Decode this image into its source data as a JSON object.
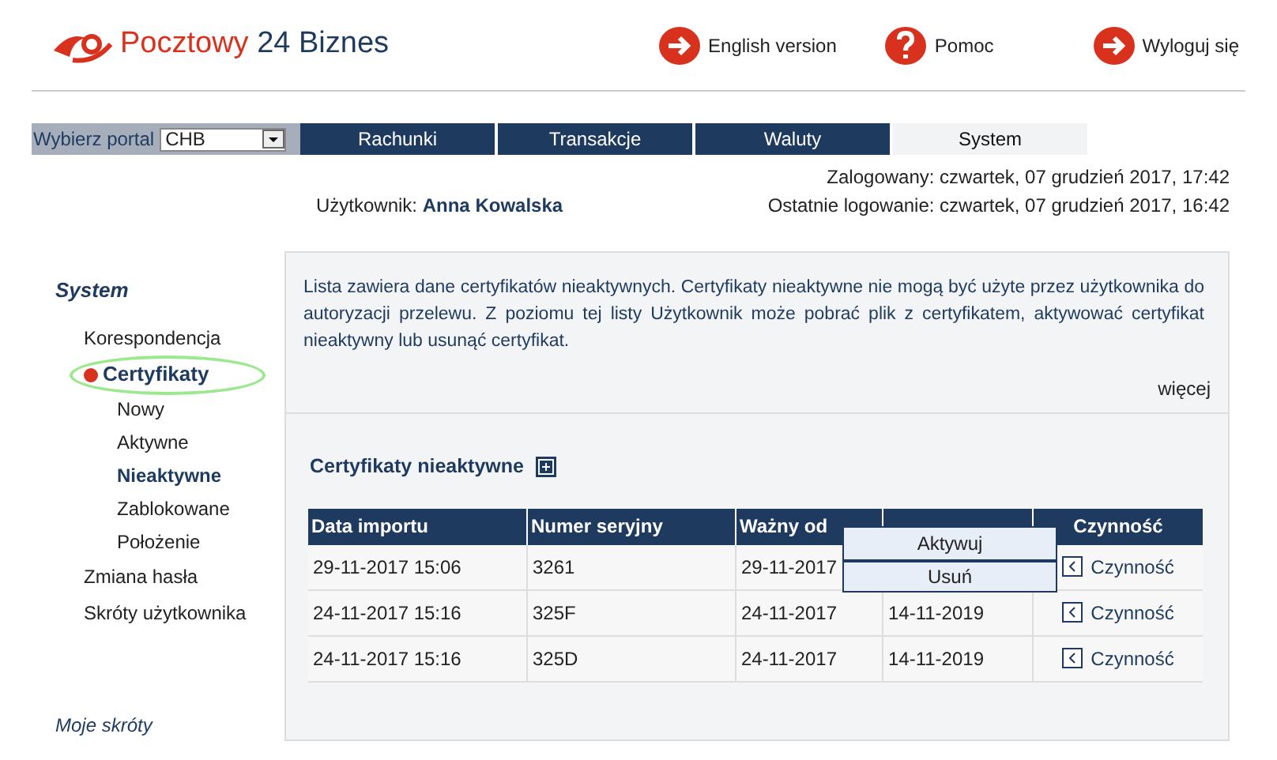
{
  "logo": {
    "text_red": "Pocztowy",
    "text_blue": "24 Biznes"
  },
  "header_links": [
    {
      "kind": "arrow",
      "label": "English version"
    },
    {
      "kind": "help",
      "label": "Pomoc"
    },
    {
      "kind": "arrow",
      "label": "Wyloguj się"
    }
  ],
  "portal": {
    "label": "Wybierz portal",
    "value": "CHB"
  },
  "tabs": [
    {
      "label": "Rachunki",
      "selected": false
    },
    {
      "label": "Transakcje",
      "selected": false
    },
    {
      "label": "Waluty",
      "selected": false
    },
    {
      "label": "System",
      "selected": true
    }
  ],
  "user": {
    "label": "Użytkownik:",
    "name": "Anna Kowalska",
    "logged_in": "Zalogowany: czwartek, 07 grudzień 2017, 17:42",
    "last_login": "Ostatnie logowanie: czwartek, 07 grudzień 2017, 16:42"
  },
  "sidebar": {
    "title": "System",
    "items": [
      {
        "label": "Korespondencja",
        "selected": false
      },
      {
        "label": "Certyfikaty",
        "selected": true,
        "children": [
          {
            "label": "Nowy",
            "selected": false
          },
          {
            "label": "Aktywne",
            "selected": false
          },
          {
            "label": "Nieaktywne",
            "selected": true
          },
          {
            "label": "Zablokowane",
            "selected": false
          },
          {
            "label": "Położenie",
            "selected": false
          }
        ]
      },
      {
        "label": "Zmiana hasła",
        "selected": false
      },
      {
        "label": "Skróty użytkownika",
        "selected": false
      }
    ],
    "footer": "Moje skróty"
  },
  "info": {
    "text": "Lista zawiera dane certyfikatów nieaktywnych. Certyfikaty nieaktywne nie mogą być użyte przez użytkownika do autoryzacji przelewu. Z poziomu tej listy Użytkownik może pobrać plik z certyfikatem, aktywować certyfikat nieaktywny lub usunąć certyfikat.",
    "more": "więcej"
  },
  "section_title": "Certyfikaty nieaktywne",
  "table": {
    "columns": [
      "Data importu",
      "Numer seryjny",
      "Ważny od",
      "Czynność"
    ],
    "rows": [
      {
        "cells": [
          "29-11-2017 15:06",
          "3261",
          "29-11-2017"
        ],
        "action": "Czynność"
      },
      {
        "cells": [
          "24-11-2017 15:16",
          "325F",
          "24-11-2017",
          "14-11-2019"
        ],
        "action": "Czynność"
      },
      {
        "cells": [
          "24-11-2017 15:16",
          "325D",
          "24-11-2017",
          "14-11-2019"
        ],
        "action": "Czynność"
      }
    ]
  },
  "context_menu": [
    "Aktywuj",
    "Usuń"
  ]
}
